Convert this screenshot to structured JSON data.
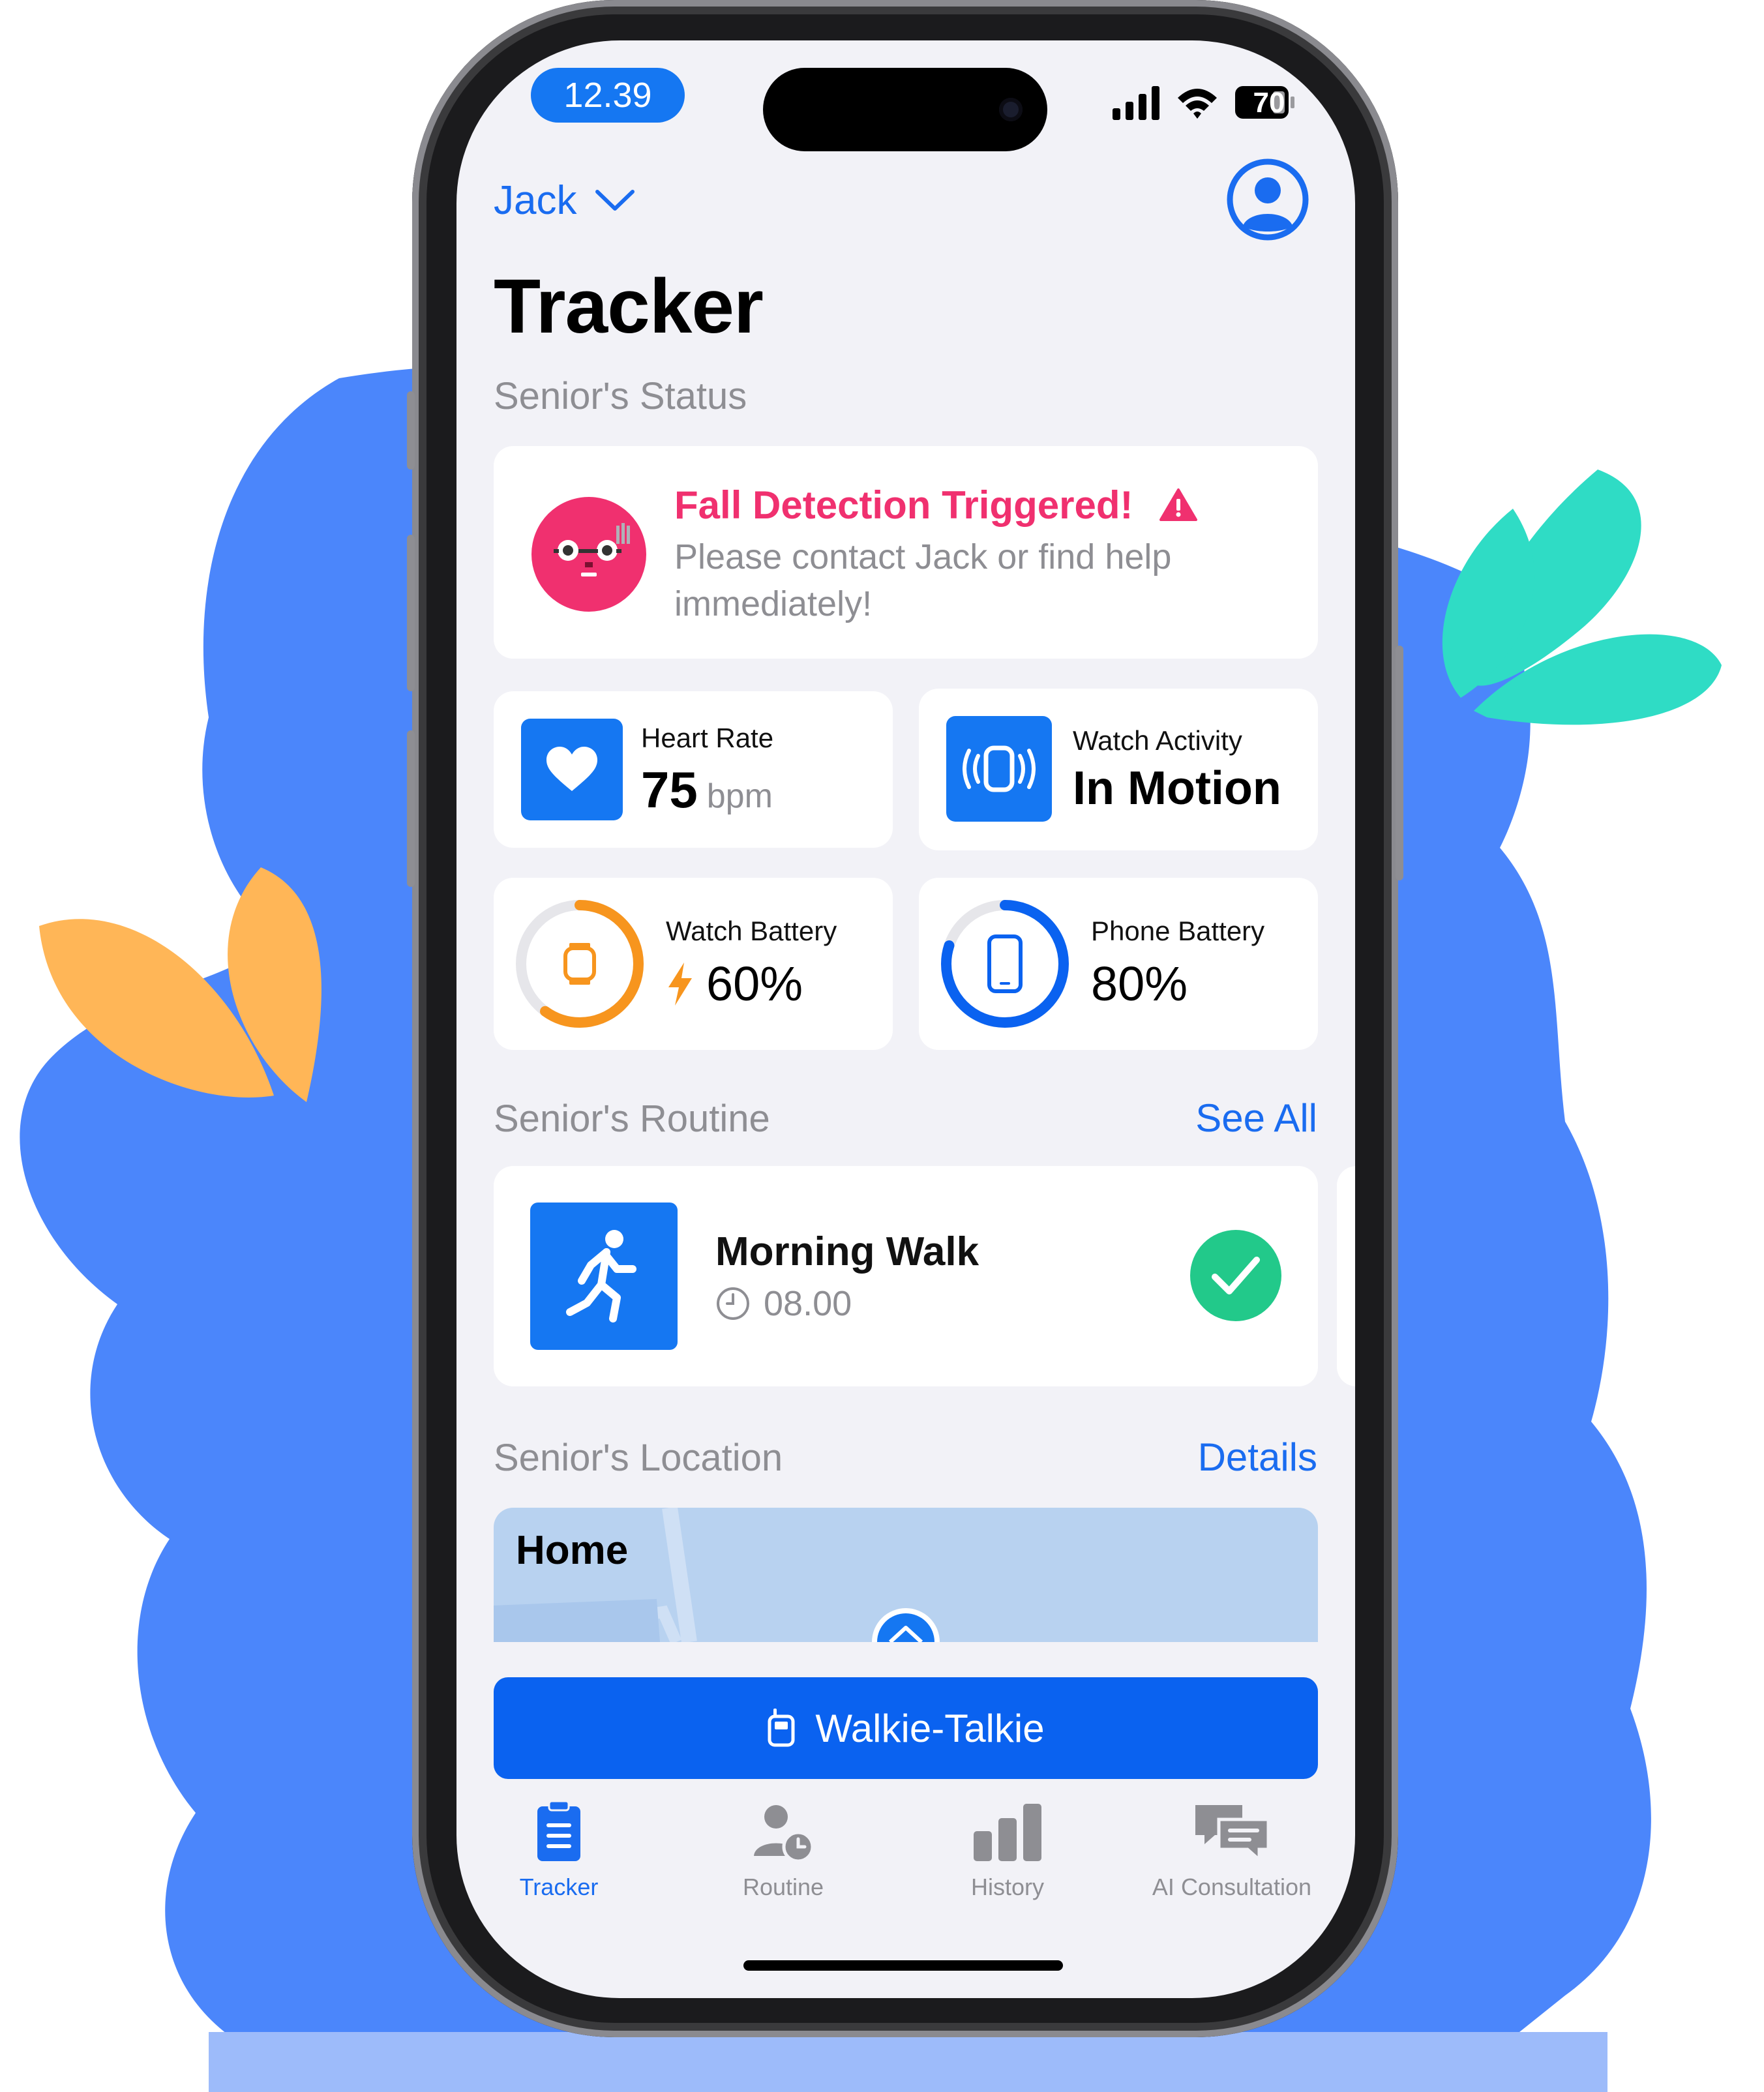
{
  "status_bar": {
    "time": "12.39",
    "battery": "70"
  },
  "header": {
    "user_name": "Jack",
    "title": "Tracker"
  },
  "status_section": {
    "heading": "Senior's Status"
  },
  "alert": {
    "title": "Fall Detection Triggered!",
    "message": "Please contact Jack or find help immediately!"
  },
  "heart_rate": {
    "label": "Heart Rate",
    "value": "75",
    "unit": "bpm"
  },
  "watch_activity": {
    "label": "Watch Activity",
    "value": "In Motion"
  },
  "watch_battery": {
    "label": "Watch Battery",
    "value": "60%",
    "level": 0.6
  },
  "phone_battery": {
    "label": "Phone Battery",
    "value": "80%",
    "level": 0.8
  },
  "routine_section": {
    "heading": "Senior's Routine",
    "link": "See All"
  },
  "routine": {
    "title": "Morning Walk",
    "time": "08.00",
    "completed": true
  },
  "location_section": {
    "heading": "Senior's Location",
    "link": "Details"
  },
  "map": {
    "label": "Home"
  },
  "walkie_talkie": {
    "label": "Walkie-Talkie"
  },
  "tabs": [
    {
      "label": "Tracker",
      "icon": "clipboard-icon",
      "active": true
    },
    {
      "label": "Routine",
      "icon": "person-clock-icon",
      "active": false
    },
    {
      "label": "History",
      "icon": "bar-chart-icon",
      "active": false
    },
    {
      "label": "AI Consultation",
      "icon": "chat-bubbles-icon",
      "active": false
    }
  ],
  "colors": {
    "accent": "#1577f2",
    "alert": "#f0306f",
    "success": "#22c98a",
    "warning": "#f7951e",
    "blob": "#4b86fb",
    "leaf_teal": "#2fdcc5",
    "leaf_orange": "#ffb657"
  }
}
